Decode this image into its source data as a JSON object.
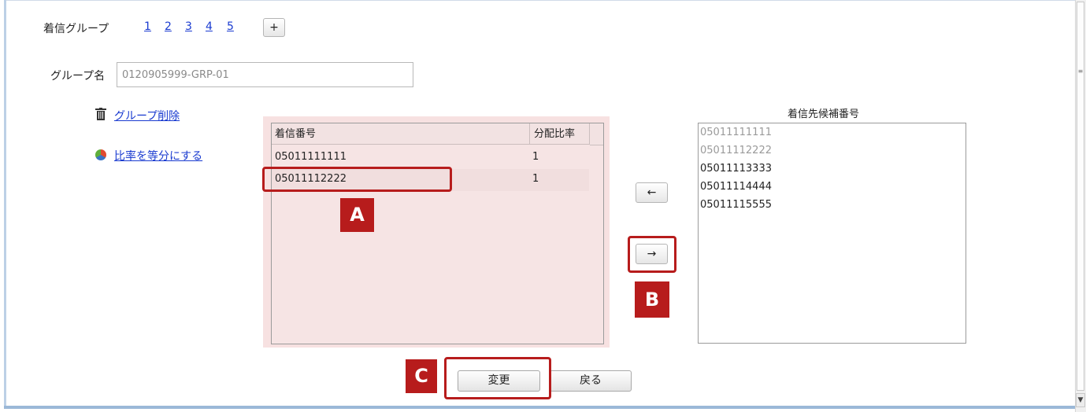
{
  "group_bar": {
    "label": "着信グループ",
    "numbers": [
      "1",
      "2",
      "3",
      "4",
      "5"
    ],
    "add_label": "+"
  },
  "group_name": {
    "label": "グループ名",
    "value": "0120905999-GRP-01"
  },
  "actions": {
    "delete_label": "グループ削除",
    "equalize_label": "比率を等分にする"
  },
  "table": {
    "headers": [
      "着信番号",
      "分配比率"
    ],
    "rows": [
      [
        "05011111111",
        "1"
      ],
      [
        "05011112222",
        "1"
      ]
    ]
  },
  "candidates": {
    "title": "着信先候補番号",
    "items": [
      {
        "number": "05011111111",
        "disabled": true
      },
      {
        "number": "05011112222",
        "disabled": true
      },
      {
        "number": "05011113333",
        "disabled": false
      },
      {
        "number": "05011114444",
        "disabled": false
      },
      {
        "number": "05011115555",
        "disabled": false
      }
    ]
  },
  "move_buttons": {
    "left": "←",
    "right": "→"
  },
  "footer": {
    "change_label": "変更",
    "back_label": "戻る"
  },
  "annotations": {
    "a": "A",
    "b": "B",
    "c": "C"
  },
  "colors": {
    "link": "#1a3bd0",
    "highlight": "#b71c1c",
    "table_background": "#f7e1e1",
    "disabled_text": "#9a9a9a"
  },
  "icons": {
    "delete": "trash-icon",
    "equalize": "pie-chart-icon"
  }
}
